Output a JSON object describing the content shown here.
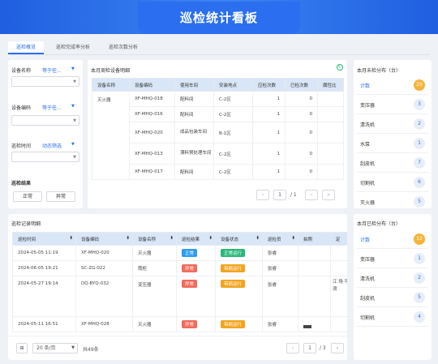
{
  "header": {
    "title": "巡检统计看板"
  },
  "tabs": [
    {
      "label": "巡检概览"
    },
    {
      "label": "巡检完成率分析"
    },
    {
      "label": "巡检次数分析"
    }
  ],
  "filters": {
    "device_name_label": "设备名称",
    "device_name_mode": "等于任...",
    "device_code_label": "设备编码",
    "device_code_mode": "等于任...",
    "time_label": "巡检时间",
    "time_mode": "动态筛选",
    "result_label": "巡检结果",
    "result_normal": "正常",
    "result_abnormal": "异常"
  },
  "weekly": {
    "title": "本月周检设备明细",
    "columns": [
      "设备名称",
      "设备编码",
      "使用车间",
      "安装地点",
      "应检次数",
      "已检次数",
      "属性比"
    ],
    "group_name": "灭火器",
    "rows": [
      {
        "code": "XF-MHQ-018",
        "workshop": "配料间",
        "place": "C-2区",
        "due": "1",
        "done": "0"
      },
      {
        "code": "XF-MHQ-016",
        "workshop": "配料间",
        "place": "C-2区",
        "due": "1",
        "done": "0"
      },
      {
        "code": "XF-MHQ-020",
        "workshop": "成品包装车间",
        "place": "B-1区",
        "due": "1",
        "done": "0"
      },
      {
        "code": "XF-MHQ-013",
        "workshop": "漂料预处理车间",
        "place": "C-2区",
        "due": "1",
        "done": "0"
      },
      {
        "code": "XF-MHQ-017",
        "workshop": "配料间",
        "place": "C-2区",
        "due": "1",
        "done": "0"
      }
    ],
    "page_current": "1",
    "page_total": "/ 1"
  },
  "dist_unchecked": {
    "title": "本月未检分布（台）",
    "total_label": "计数",
    "total": "29",
    "items": [
      {
        "name": "变压器",
        "count": "3"
      },
      {
        "name": "清洗机",
        "count": "2"
      },
      {
        "name": "水泵",
        "count": "1"
      },
      {
        "name": "刮皮机",
        "count": "7"
      },
      {
        "name": "切割机",
        "count": "6"
      },
      {
        "name": "灭火器",
        "count": "5"
      }
    ]
  },
  "dist_checked": {
    "title": "本月已检分布（台）",
    "total_label": "计数",
    "total": "12",
    "items": [
      {
        "name": "变压器",
        "count": "1"
      },
      {
        "name": "清洗机",
        "count": "2"
      },
      {
        "name": "刮皮机",
        "count": "5"
      },
      {
        "name": "切割机",
        "count": "4"
      }
    ]
  },
  "records": {
    "title": "巡检记录明细",
    "columns": [
      "巡检时间",
      "设备编码",
      "设备名称",
      "巡检结果",
      "设备状态",
      "巡检员",
      "拍照",
      "定"
    ],
    "rows": [
      {
        "time": "2024-05-05 11:19",
        "code": "XF-MHQ-020",
        "name": "灭火器",
        "result": "正常",
        "status": "正常运行",
        "inspector": "张睿",
        "photo": "",
        "note": ""
      },
      {
        "time": "2024-06-05 19:21",
        "code": "SC-ZG-022",
        "name": "筒柜",
        "result": "异常",
        "status": "带病运行",
        "inspector": "张睿",
        "photo": "",
        "note": ""
      },
      {
        "time": "2024-05-27 19:14",
        "code": "DQ-BYQ-032",
        "name": "变压器",
        "result": "异常",
        "status": "带病运行",
        "inspector": "张睿",
        "photo": "",
        "note": "江 场 可 须"
      },
      {
        "time": "2024-05-11 16:51",
        "code": "XF-MHQ-028",
        "name": "灭火器",
        "result": "异常",
        "status": "带病运行",
        "inspector": "张睿",
        "photo": "",
        "note": ""
      }
    ],
    "page_size": "20 条/页",
    "total_text": "共49条",
    "page_current": "1",
    "page_total": "/ 3"
  },
  "colors": {
    "primary": "#2b6ff0",
    "ok": "#2f9bf0",
    "bad": "#f26b5b",
    "run_ok": "#2ab87a",
    "run_bad": "#f2a41f",
    "count_badge": "#f6b43a"
  }
}
